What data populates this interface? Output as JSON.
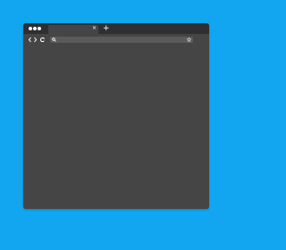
{
  "colors": {
    "background": "#13a6f0",
    "window": "#454545",
    "titlebar": "#2f2f2f",
    "address_bar": "#5a5a5a",
    "icon": "#ffffff"
  },
  "titlebar": {
    "traffic_lights": [
      "dot",
      "dot",
      "dot"
    ],
    "tab": {
      "close_glyph": "×"
    },
    "new_tab_glyph": "+"
  },
  "toolbar": {
    "back_icon": "chevron-left-icon",
    "forward_icon": "chevron-right-icon",
    "reload_icon": "reload-icon",
    "address": {
      "value": "",
      "search_icon": "search-icon",
      "bookmark_icon": "star-icon"
    },
    "menu_icon": "menu-icon"
  },
  "content": {
    "text": ""
  }
}
